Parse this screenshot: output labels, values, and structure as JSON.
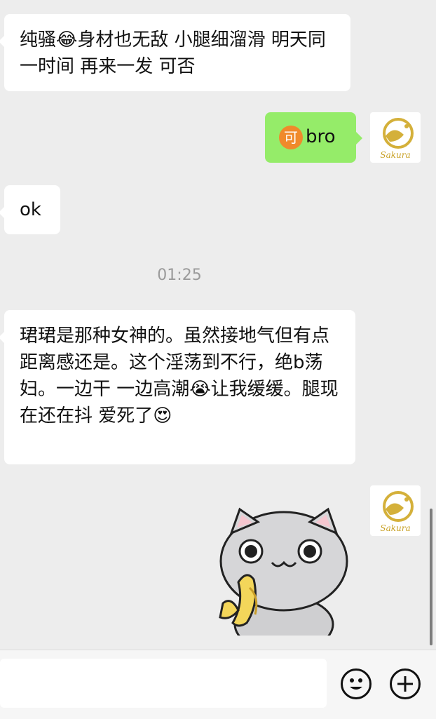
{
  "messages": [
    {
      "side": "in",
      "text": "纯骚😂身材也无敌 小腿细溜滑 明天同一时间 再来一发 可否"
    },
    {
      "side": "out",
      "badge": "可",
      "text": "bro"
    },
    {
      "side": "in",
      "text": "ok"
    },
    {
      "side": "in",
      "text": "珺珺是那种女神的。虽然接地气但有点距离感还是。这个淫荡到不行，绝b荡妇。一边干 一边高潮😭让我缓缓。腿现在还在抖 爱死了😍"
    }
  ],
  "timestamp": "01:25",
  "avatar": {
    "signature": "Sakura"
  },
  "input": {
    "value": ""
  },
  "colors": {
    "incoming": "#ffffff",
    "outgoing": "#95ec69",
    "background": "#ededed"
  },
  "icons": {
    "emoji": "emoji-face-icon",
    "add": "plus-circle-icon"
  }
}
